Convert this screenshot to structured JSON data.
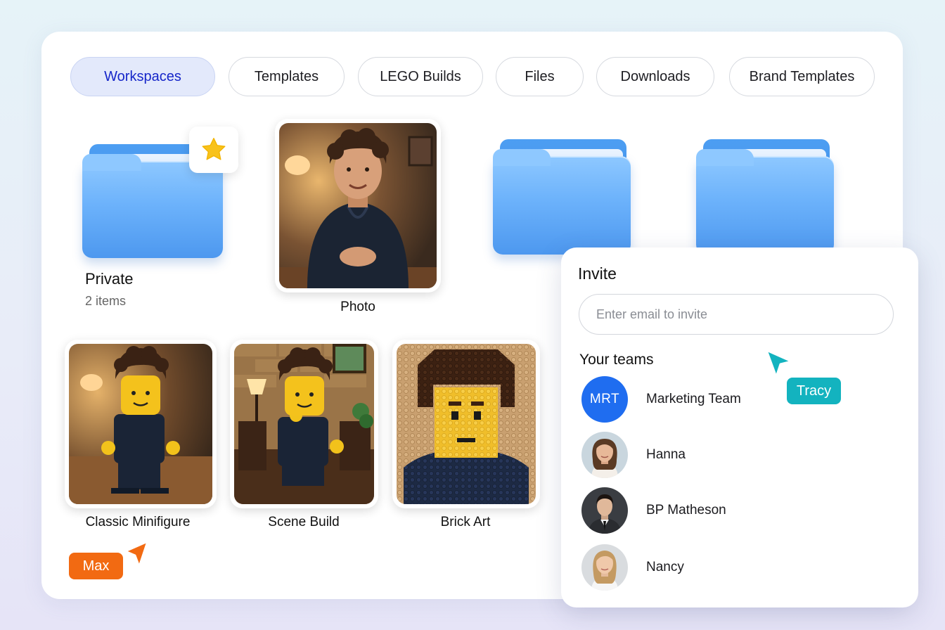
{
  "tabs": [
    {
      "label": "Workspaces",
      "active": true
    },
    {
      "label": "Templates"
    },
    {
      "label": "LEGO Builds"
    },
    {
      "label": "Files"
    },
    {
      "label": "Downloads"
    },
    {
      "label": "Brand Templates"
    }
  ],
  "items": {
    "private": {
      "name": "Private",
      "count": "2 items"
    },
    "photo": {
      "name": "Photo"
    },
    "classic": {
      "name": "Classic Minifigure"
    },
    "scene": {
      "name": "Scene Build"
    },
    "brick": {
      "name": "Brick Art"
    }
  },
  "invite": {
    "title": "Invite",
    "placeholder": "Enter email to invite",
    "teams_title": "Your teams",
    "members": [
      {
        "initials": "MRT",
        "name": "Marketing Team"
      },
      {
        "name": "Hanna"
      },
      {
        "name": "BP Matheson"
      },
      {
        "name": "Nancy"
      }
    ]
  },
  "cursors": [
    {
      "name": "Max",
      "color": "#f26a12"
    },
    {
      "name": "Tracy",
      "color": "#13b3bf"
    }
  ],
  "colors": {
    "accent": "#1626c9",
    "tab_active_bg": "#e3e9fb",
    "folder_blue": "#6cb2fb",
    "team_avatar": "#1f6df0",
    "star": "#f8c21b"
  },
  "icons": [
    "folder-icon",
    "star-icon",
    "cursor-arrow-icon"
  ]
}
